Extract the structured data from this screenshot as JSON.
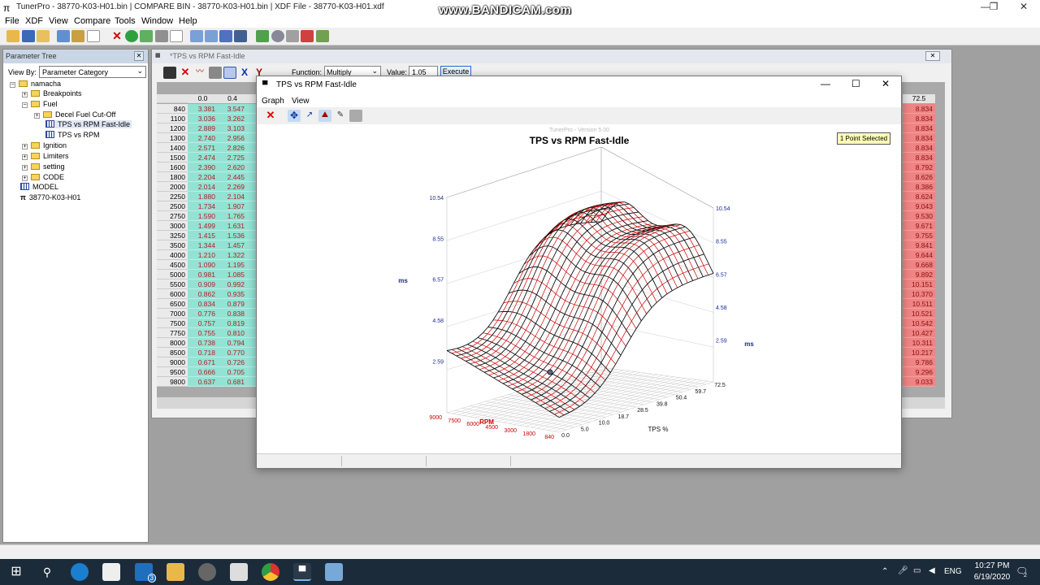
{
  "app": {
    "title": "TunerPro - 38770-K03-H01.bin | COMPARE BIN - 38770-K03-H01.bin | XDF File - 38770-K03-H01.xdf",
    "watermark": "www.BANDICAM.com",
    "menu": [
      "File",
      "XDF",
      "View",
      "Compare",
      "Tools",
      "Window",
      "Help"
    ]
  },
  "param_tree": {
    "title": "Parameter Tree",
    "view_by_label": "View By:",
    "view_by_value": "Parameter Category",
    "close_glyph": "✕",
    "items": [
      {
        "label": "namacha"
      },
      {
        "label": "Breakpoints"
      },
      {
        "label": "Fuel"
      },
      {
        "label": "Decel Fuel Cut-Off"
      },
      {
        "label": "TPS vs RPM Fast-Idle"
      },
      {
        "label": "TPS vs RPM"
      },
      {
        "label": "Ignition"
      },
      {
        "label": "Limiters"
      },
      {
        "label": "setting"
      },
      {
        "label": "CODE"
      },
      {
        "label": "MODEL"
      },
      {
        "label": "38770-K03-H01"
      }
    ]
  },
  "table_window": {
    "title": "*TPS vs RPM Fast-Idle",
    "function_label": "Function:",
    "function_value": "Multiply",
    "value_label": "Value:",
    "value_value": "1.05",
    "execute_label": "Execute",
    "close_glyph": "✕",
    "col_headers": [
      "0.0",
      "0.4"
    ],
    "last_col_header": "72.5",
    "rows": [
      {
        "rpm": "840",
        "c0": "3.381",
        "c1": "3.547",
        "last": "8.834"
      },
      {
        "rpm": "1100",
        "c0": "3.036",
        "c1": "3.262",
        "last": "8.834"
      },
      {
        "rpm": "1200",
        "c0": "2.889",
        "c1": "3.103",
        "last": "8.834"
      },
      {
        "rpm": "1300",
        "c0": "2.740",
        "c1": "2.956",
        "last": "8.834"
      },
      {
        "rpm": "1400",
        "c0": "2.571",
        "c1": "2.826",
        "last": "8.834"
      },
      {
        "rpm": "1500",
        "c0": "2.474",
        "c1": "2.725",
        "last": "8.834"
      },
      {
        "rpm": "1600",
        "c0": "2.390",
        "c1": "2.620",
        "last": "8.792"
      },
      {
        "rpm": "1800",
        "c0": "2.204",
        "c1": "2.445",
        "last": "8.626"
      },
      {
        "rpm": "2000",
        "c0": "2.014",
        "c1": "2.269",
        "last": "8.386"
      },
      {
        "rpm": "2250",
        "c0": "1.880",
        "c1": "2.104",
        "last": "8.624"
      },
      {
        "rpm": "2500",
        "c0": "1.734",
        "c1": "1.907",
        "last": "9.043"
      },
      {
        "rpm": "2750",
        "c0": "1.590",
        "c1": "1.765",
        "last": "9.530"
      },
      {
        "rpm": "3000",
        "c0": "1.499",
        "c1": "1.631",
        "last": "9.671"
      },
      {
        "rpm": "3250",
        "c0": "1.415",
        "c1": "1.536",
        "last": "9.755"
      },
      {
        "rpm": "3500",
        "c0": "1.344",
        "c1": "1.457",
        "last": "9.841"
      },
      {
        "rpm": "4000",
        "c0": "1.210",
        "c1": "1.322",
        "last": "9.644"
      },
      {
        "rpm": "4500",
        "c0": "1.090",
        "c1": "1.195",
        "last": "9.668"
      },
      {
        "rpm": "5000",
        "c0": "0.981",
        "c1": "1.085",
        "last": "9.892"
      },
      {
        "rpm": "5500",
        "c0": "0.909",
        "c1": "0.992",
        "last": "10.151"
      },
      {
        "rpm": "6000",
        "c0": "0.862",
        "c1": "0.935",
        "last": "10.370"
      },
      {
        "rpm": "6500",
        "c0": "0.834",
        "c1": "0.879",
        "last": "10.511"
      },
      {
        "rpm": "7000",
        "c0": "0.776",
        "c1": "0.838",
        "last": "10.521"
      },
      {
        "rpm": "7500",
        "c0": "0.757",
        "c1": "0.819",
        "last": "10.542"
      },
      {
        "rpm": "7750",
        "c0": "0.755",
        "c1": "0.810",
        "last": "10.427"
      },
      {
        "rpm": "8000",
        "c0": "0.738",
        "c1": "0.794",
        "last": "10.311"
      },
      {
        "rpm": "8500",
        "c0": "0.718",
        "c1": "0.770",
        "last": "10.217"
      },
      {
        "rpm": "9000",
        "c0": "0.671",
        "c1": "0.726",
        "last": "9.786"
      },
      {
        "rpm": "9500",
        "c0": "0.666",
        "c1": "0.705",
        "last": "9.296"
      },
      {
        "rpm": "9800",
        "c0": "0.637",
        "c1": "0.681",
        "last": "9.033"
      }
    ]
  },
  "graph_window": {
    "title": "TPS vs RPM Fast-Idle",
    "menu": [
      "Graph",
      "View"
    ],
    "version_watermark": "TunerPro - Version 5.00",
    "badge": "1 Point Selected",
    "chart_title": "TPS vs RPM Fast-Idle",
    "z_axis_label": "ms",
    "z_ticks_left": [
      "10.54",
      "8.55",
      "6.57",
      "4.58",
      "2.59"
    ],
    "z_ticks_right": [
      "10.54",
      "8.55",
      "6.57",
      "4.58",
      "2.59"
    ],
    "rpm_axis_label": "RPM",
    "rpm_ticks": [
      "9000",
      "7500",
      "6000",
      "4500",
      "3000",
      "1800",
      "840"
    ],
    "tps_axis_label": "TPS %",
    "tps_ticks": [
      "0.0",
      "5.0",
      "10.0",
      "18.7",
      "28.5",
      "39.8",
      "50.4",
      "59.7",
      "72.5"
    ]
  },
  "taskbar": {
    "lang": "ENG",
    "time": "10:27 PM",
    "date": "6/19/2020",
    "mail_badge": "3",
    "notif_badge": "2"
  },
  "colors": {
    "accent_green": "#93e3d4",
    "accent_red": "#f08484",
    "mesh_red": "#cc0000",
    "taskbar": "#1c2b3a"
  }
}
